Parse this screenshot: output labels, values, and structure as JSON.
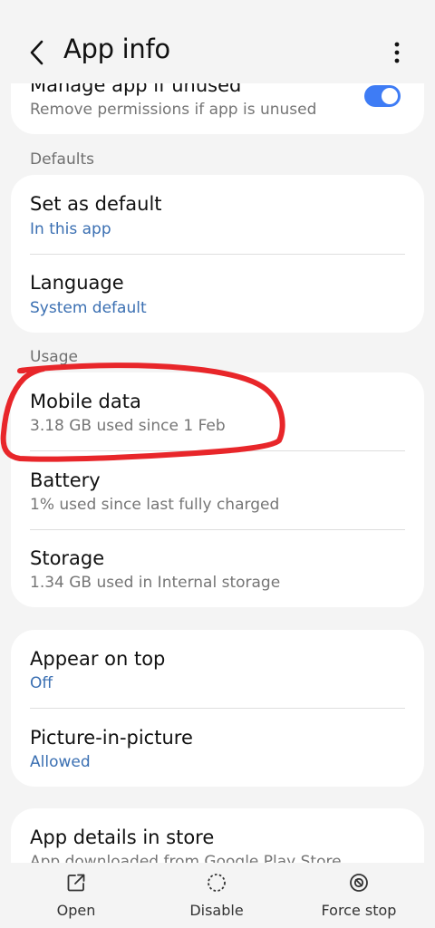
{
  "header": {
    "title": "App info"
  },
  "top_card": {
    "title": "Manage app if unused",
    "subtitle": "Remove permissions if app is unused",
    "toggle_on": true
  },
  "sections": {
    "defaults_label": "Defaults",
    "usage_label": "Usage"
  },
  "defaults": {
    "set_default": {
      "title": "Set as default",
      "subtitle": "In this app"
    },
    "language": {
      "title": "Language",
      "subtitle": "System default"
    }
  },
  "usage": {
    "mobile_data": {
      "title": "Mobile data",
      "subtitle": "3.18 GB used since 1 Feb"
    },
    "battery": {
      "title": "Battery",
      "subtitle": "1% used since last fully charged"
    },
    "storage": {
      "title": "Storage",
      "subtitle": "1.34 GB used in Internal storage"
    }
  },
  "permissions": {
    "appear_on_top": {
      "title": "Appear on top",
      "subtitle": "Off"
    },
    "pip": {
      "title": "Picture-in-picture",
      "subtitle": "Allowed"
    }
  },
  "store": {
    "title": "App details in store",
    "subtitle": "App downloaded from Google Play Store"
  },
  "bottom_bar": {
    "open": "Open",
    "disable": "Disable",
    "force_stop": "Force stop"
  },
  "colors": {
    "accent_blue": "#3a6fb2",
    "toggle_blue": "#3e7cf5",
    "annotation_red": "#e8262a",
    "background": "#f4f4f4"
  }
}
